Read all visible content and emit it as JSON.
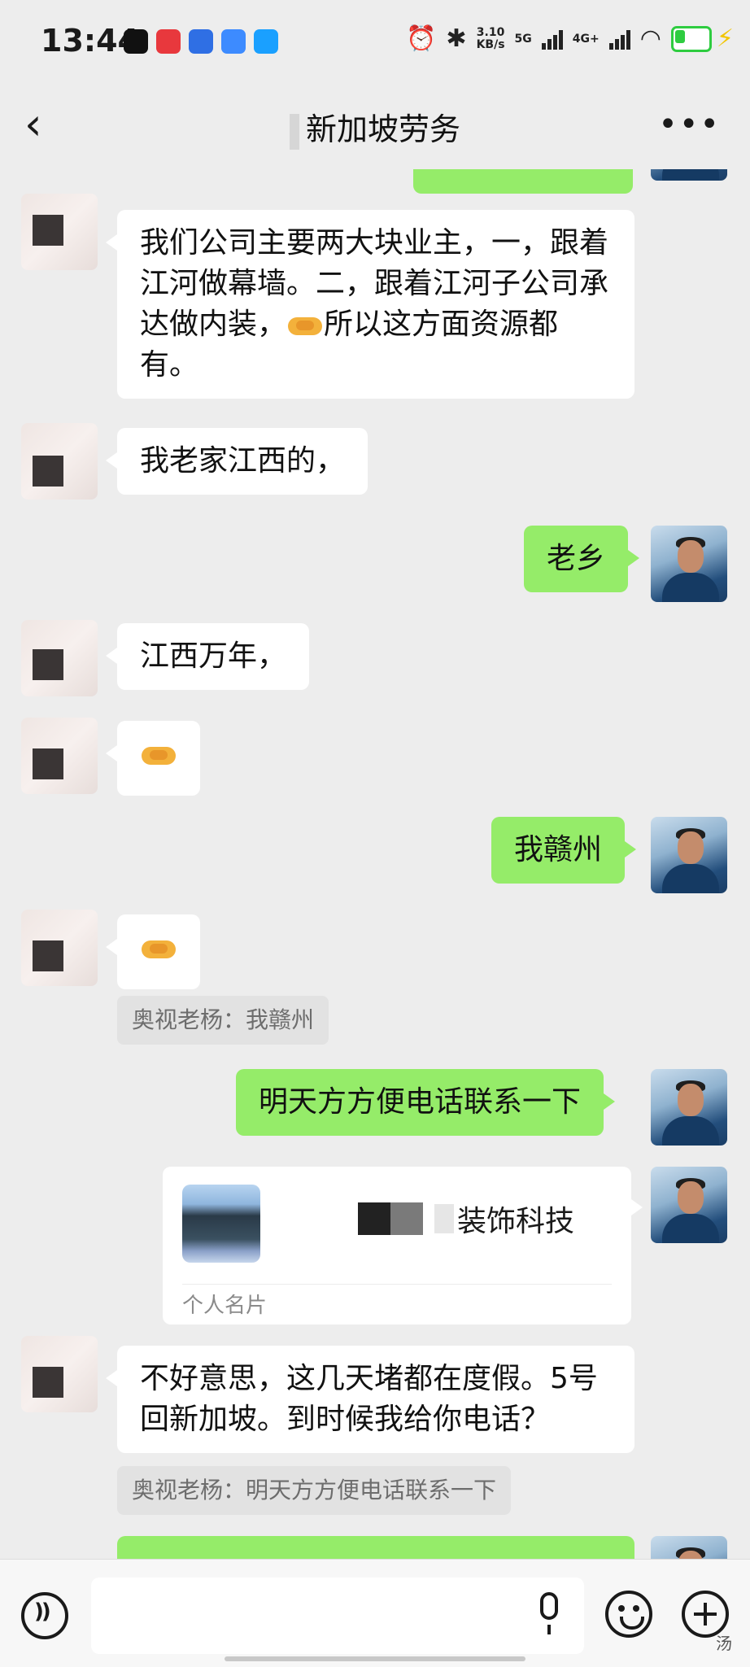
{
  "status_bar": {
    "time": "13:44",
    "apps": [
      {
        "icon": "tiktok-icon",
        "color": "#111111"
      },
      {
        "icon": "toutiao-icon",
        "color": "#e8383d"
      },
      {
        "icon": "baidu-icon",
        "color": "#2f6fe4"
      },
      {
        "icon": "browser-icon",
        "color": "#3d8bff"
      },
      {
        "icon": "app-icon",
        "color": "#1aa0ff"
      }
    ],
    "speed_value": "3.10",
    "speed_unit": "KB/s",
    "net1": "5G",
    "net2": "4G+",
    "icons": [
      "alarm-icon",
      "bluetooth-icon",
      "wifi-icon",
      "battery-icon",
      "charging-icon"
    ]
  },
  "header": {
    "back_icon": "back-chevron-icon",
    "title": "新加坡劳务",
    "more_icon": "more-icon"
  },
  "messages": [
    {
      "side": "left",
      "text": "我们公司主要两大块业主，一，跟着江河做幕墙。二，跟着江河子公司承达做内装，",
      "emoji": "handshake",
      "text_after": "所以这方面资源都有。"
    },
    {
      "side": "left",
      "text": "我老家江西的，"
    },
    {
      "side": "right",
      "text": "老乡"
    },
    {
      "side": "left",
      "text": "江西万年，"
    },
    {
      "side": "left",
      "emoji": "handshake"
    },
    {
      "side": "right",
      "text": "我赣州"
    },
    {
      "side": "left",
      "emoji": "handshake",
      "quote": "奥视老杨：我赣州"
    },
    {
      "side": "right",
      "text": "明天方方便电话联系一下"
    },
    {
      "side": "right",
      "type": "contact_card",
      "card_name_visible": "装饰科技",
      "card_label": "个人名片"
    },
    {
      "side": "left",
      "text": "不好意思，这几天堵都在度假。5号回新加坡。到时候我给你电话？",
      "quote": "奥视老杨：明天方方便电话联系一下"
    }
  ],
  "input_bar": {
    "voice_icon": "voice-mode-icon",
    "mic_icon": "mic-icon",
    "emoji_icon": "emoji-icon",
    "plus_icon": "plus-icon",
    "input_value": ""
  },
  "watermark": "汤",
  "colors": {
    "background": "#ededed",
    "bubble_sent": "#95ec69",
    "bubble_received": "#ffffff",
    "quote_bg": "#e2e2e2"
  }
}
